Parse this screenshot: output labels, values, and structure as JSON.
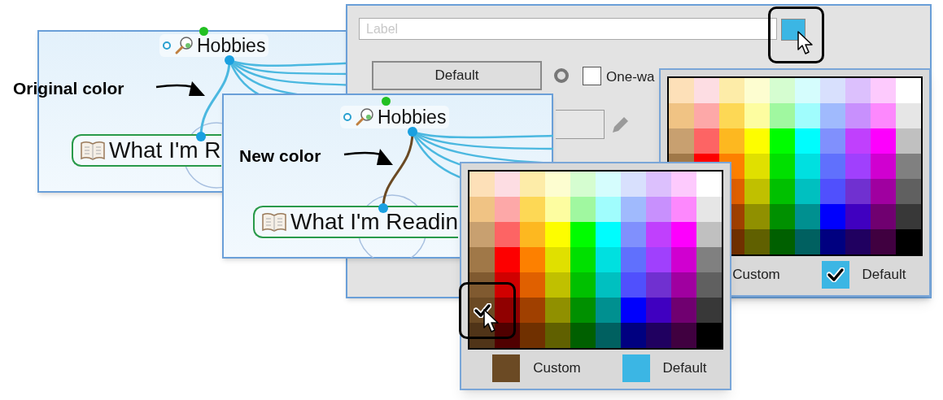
{
  "annotations": [
    {
      "text": "Original color"
    },
    {
      "text": "New color"
    }
  ],
  "map_panels": [
    {
      "topic": "Hobbies",
      "child": "What I'm R",
      "color": "#4bb8e0"
    },
    {
      "topic": "Hobbies",
      "child": "What I'm Readin",
      "color": "#6b4a24"
    }
  ],
  "dialog": {
    "label_field": {
      "placeholder": "Label"
    },
    "color_button": {
      "color": "#3bb6e4"
    },
    "default_button": "Default",
    "one_way": {
      "label": "One-wa",
      "checked": false
    }
  },
  "palettes": [
    {
      "rows": [
        [
          {
            "color": "#fde0b8",
            "selected": false
          },
          {
            "color": "#fddde3",
            "selected": false
          },
          {
            "color": "#fdeca8",
            "selected": false
          },
          {
            "color": "#fdfdd0",
            "selected": false
          },
          {
            "color": "#d5fdd0",
            "selected": false
          },
          {
            "color": "#d5fdfd",
            "selected": false
          },
          {
            "color": "#d8e0fd",
            "selected": false
          },
          {
            "color": "#dcc0fd",
            "selected": false
          },
          {
            "color": "#fdcafd",
            "selected": false
          },
          {
            "color": "#ffffff",
            "selected": false
          }
        ],
        [
          {
            "color": "#f0c384",
            "selected": false
          },
          {
            "color": "#fda8a8",
            "selected": false
          },
          {
            "color": "#fdd855",
            "selected": false
          },
          {
            "color": "#fdfda0",
            "selected": false
          },
          {
            "color": "#a0f8a0",
            "selected": false
          },
          {
            "color": "#a0fdfd",
            "selected": false
          },
          {
            "color": "#a0bafd",
            "selected": false
          },
          {
            "color": "#c890fd",
            "selected": false
          },
          {
            "color": "#fd88fd",
            "selected": false
          },
          {
            "color": "#e6e6e6",
            "selected": false
          }
        ],
        [
          {
            "color": "#c8a070",
            "selected": false
          },
          {
            "color": "#fd6464",
            "selected": false
          },
          {
            "color": "#fdb820",
            "selected": false
          },
          {
            "color": "#fdfd00",
            "selected": false
          },
          {
            "color": "#00fd00",
            "selected": false
          },
          {
            "color": "#00fdfd",
            "selected": false
          },
          {
            "color": "#8090fd",
            "selected": false
          },
          {
            "color": "#c040fd",
            "selected": false
          },
          {
            "color": "#fd00fd",
            "selected": false
          },
          {
            "color": "#c0c0c0",
            "selected": false
          }
        ],
        [
          {
            "color": "#a07848",
            "selected": false
          },
          {
            "color": "#fd0000",
            "selected": false
          },
          {
            "color": "#fd8000",
            "selected": false
          },
          {
            "color": "#e0e000",
            "selected": false
          },
          {
            "color": "#00e000",
            "selected": false
          },
          {
            "color": "#00e0e0",
            "selected": false
          },
          {
            "color": "#6070fd",
            "selected": false
          },
          {
            "color": "#a040fd",
            "selected": false
          },
          {
            "color": "#d000d0",
            "selected": false
          },
          {
            "color": "#808080",
            "selected": false
          }
        ],
        [
          null,
          null,
          {
            "color": "#e06000",
            "selected": false
          },
          {
            "color": "#c0c000",
            "selected": false
          },
          {
            "color": "#00c000",
            "selected": false
          },
          {
            "color": "#00c0c0",
            "selected": false
          },
          {
            "color": "#5050fd",
            "selected": false
          },
          {
            "color": "#7030d0",
            "selected": false
          },
          {
            "color": "#a000a0",
            "selected": false
          },
          {
            "color": "#606060",
            "selected": false
          }
        ],
        [
          null,
          null,
          {
            "color": "#a04000",
            "selected": false
          },
          {
            "color": "#909000",
            "selected": false
          },
          {
            "color": "#009000",
            "selected": false
          },
          {
            "color": "#009090",
            "selected": false
          },
          {
            "color": "#0000fd",
            "selected": false
          },
          {
            "color": "#4000c0",
            "selected": false
          },
          {
            "color": "#700070",
            "selected": false
          },
          {
            "color": "#383838",
            "selected": false
          }
        ],
        [
          null,
          null,
          {
            "color": "#703000",
            "selected": false
          },
          {
            "color": "#606000",
            "selected": false
          },
          {
            "color": "#006000",
            "selected": false
          },
          {
            "color": "#006060",
            "selected": false
          },
          {
            "color": "#000080",
            "selected": false
          },
          {
            "color": "#200060",
            "selected": false
          },
          {
            "color": "#400040",
            "selected": false
          },
          {
            "color": "#000000",
            "selected": false
          }
        ]
      ],
      "footer": [
        {
          "label": "Custom"
        },
        {
          "label": "Default",
          "color": "#3bb6e4",
          "checked": true
        }
      ]
    },
    {
      "rows": [
        [
          {
            "color": "#fde0b8",
            "selected": false
          },
          {
            "color": "#fddde3",
            "selected": false
          },
          {
            "color": "#fdeca8",
            "selected": false
          },
          {
            "color": "#fdfdd0",
            "selected": false
          },
          {
            "color": "#d5fdd0",
            "selected": false
          },
          {
            "color": "#d5fdfd",
            "selected": false
          },
          {
            "color": "#d8e0fd",
            "selected": false
          },
          {
            "color": "#dcc0fd",
            "selected": false
          },
          {
            "color": "#fdcafd",
            "selected": false
          },
          {
            "color": "#ffffff",
            "selected": false
          }
        ],
        [
          {
            "color": "#f0c384",
            "selected": false
          },
          {
            "color": "#fda8a8",
            "selected": false
          },
          {
            "color": "#fdd855",
            "selected": false
          },
          {
            "color": "#fdfda0",
            "selected": false
          },
          {
            "color": "#a0f8a0",
            "selected": false
          },
          {
            "color": "#a0fdfd",
            "selected": false
          },
          {
            "color": "#a0bafd",
            "selected": false
          },
          {
            "color": "#c890fd",
            "selected": false
          },
          {
            "color": "#fd88fd",
            "selected": false
          },
          {
            "color": "#e6e6e6",
            "selected": false
          }
        ],
        [
          {
            "color": "#c8a070",
            "selected": false
          },
          {
            "color": "#fd6464",
            "selected": false
          },
          {
            "color": "#fdb820",
            "selected": false
          },
          {
            "color": "#fdfd00",
            "selected": false
          },
          {
            "color": "#00fd00",
            "selected": false
          },
          {
            "color": "#00fdfd",
            "selected": false
          },
          {
            "color": "#8090fd",
            "selected": false
          },
          {
            "color": "#c040fd",
            "selected": false
          },
          {
            "color": "#fd00fd",
            "selected": false
          },
          {
            "color": "#c0c0c0",
            "selected": false
          }
        ],
        [
          {
            "color": "#a07848",
            "selected": false
          },
          {
            "color": "#fd0000",
            "selected": false
          },
          {
            "color": "#fd8000",
            "selected": false
          },
          {
            "color": "#e0e000",
            "selected": false
          },
          {
            "color": "#00e000",
            "selected": false
          },
          {
            "color": "#00e0e0",
            "selected": false
          },
          {
            "color": "#6070fd",
            "selected": false
          },
          {
            "color": "#a040fd",
            "selected": false
          },
          {
            "color": "#d000d0",
            "selected": false
          },
          {
            "color": "#808080",
            "selected": false
          }
        ],
        [
          {
            "color": "#805a30",
            "selected": false
          },
          {
            "color": "#d00000",
            "selected": false
          },
          {
            "color": "#e06000",
            "selected": false
          },
          {
            "color": "#c0c000",
            "selected": false
          },
          {
            "color": "#00c000",
            "selected": false
          },
          {
            "color": "#00c0c0",
            "selected": false
          },
          {
            "color": "#5050fd",
            "selected": false
          },
          {
            "color": "#7030d0",
            "selected": false
          },
          {
            "color": "#a000a0",
            "selected": false
          },
          {
            "color": "#606060",
            "selected": false
          }
        ],
        [
          {
            "color": "#6b4a24",
            "selected": true
          },
          {
            "color": "#900000",
            "selected": false
          },
          {
            "color": "#a04000",
            "selected": false
          },
          {
            "color": "#909000",
            "selected": false
          },
          {
            "color": "#009000",
            "selected": false
          },
          {
            "color": "#009090",
            "selected": false
          },
          {
            "color": "#0000fd",
            "selected": false
          },
          {
            "color": "#4000c0",
            "selected": false
          },
          {
            "color": "#700070",
            "selected": false
          },
          {
            "color": "#383838",
            "selected": false
          }
        ],
        [
          {
            "color": "#503418",
            "selected": false
          },
          {
            "color": "#500000",
            "selected": false
          },
          {
            "color": "#703000",
            "selected": false
          },
          {
            "color": "#606000",
            "selected": false
          },
          {
            "color": "#006000",
            "selected": false
          },
          {
            "color": "#006060",
            "selected": false
          },
          {
            "color": "#000080",
            "selected": false
          },
          {
            "color": "#200060",
            "selected": false
          },
          {
            "color": "#400040",
            "selected": false
          },
          {
            "color": "#000000",
            "selected": false
          }
        ]
      ],
      "footer": [
        {
          "label": "Custom",
          "color": "#6b4a24",
          "checked": false
        },
        {
          "label": "Default",
          "color": "#3bb6e4",
          "checked": false
        }
      ]
    }
  ]
}
